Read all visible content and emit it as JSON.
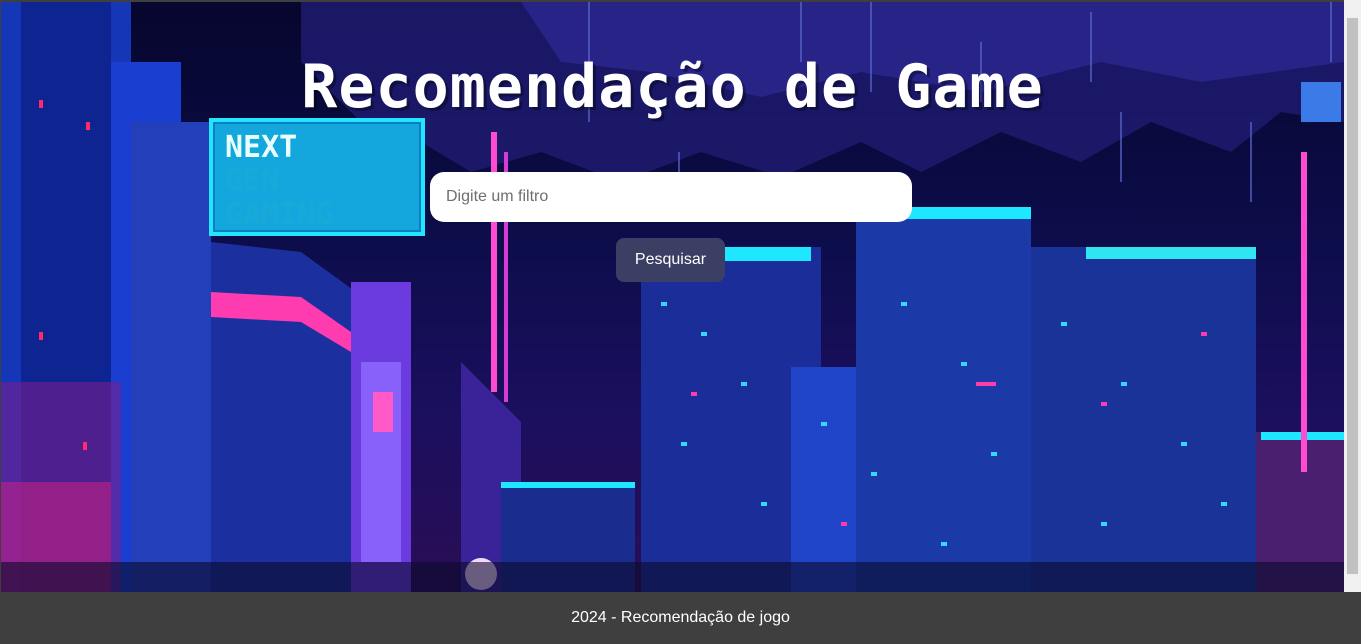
{
  "header": {
    "title": "Recomendação de Game"
  },
  "billboard": {
    "line1": "NEXT",
    "line2": "GEN",
    "line3": "GAMING"
  },
  "search": {
    "placeholder": "Digite um filtro",
    "button_label": "Pesquisar"
  },
  "footer": {
    "text": "2024 - Recomendação de jogo"
  },
  "colors": {
    "button": "#3b3f63",
    "footer": "#3f3f3f",
    "neon_cyan": "#1ee8ff",
    "neon_pink": "#ff3bb0"
  }
}
